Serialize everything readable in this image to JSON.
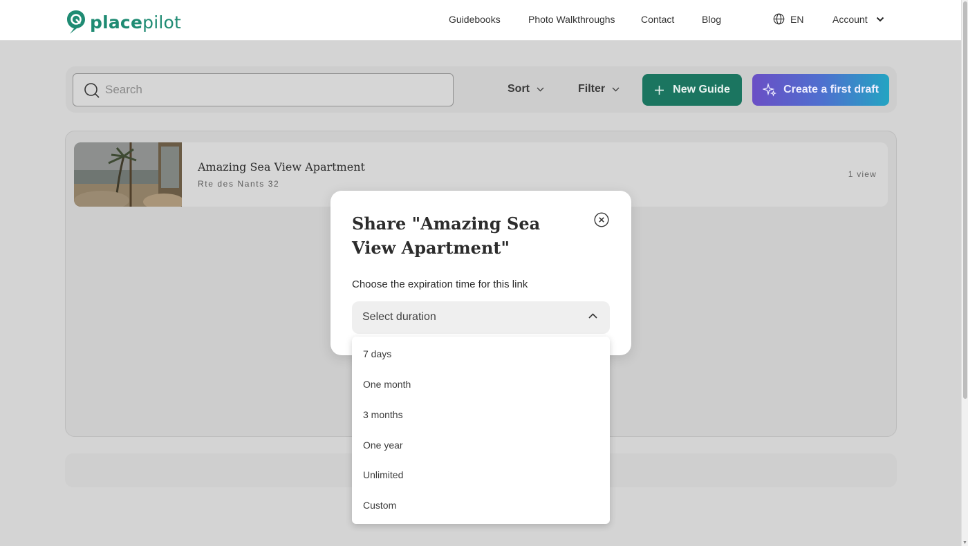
{
  "header": {
    "logo": {
      "bold": "place",
      "light": "pilot"
    },
    "nav": [
      "Guidebooks",
      "Photo Walkthroughs",
      "Contact",
      "Blog"
    ],
    "language": "EN",
    "account": "Account"
  },
  "toolbar": {
    "search_placeholder": "Search",
    "sort_label": "Sort",
    "filter_label": "Filter",
    "new_guide_label": "New Guide",
    "draft_label": "Create a first draft"
  },
  "guide": {
    "title": "Amazing Sea View Apartment",
    "address": "Rte des Nants 32",
    "views": "1 view"
  },
  "modal": {
    "title": "Share \"Amazing Sea View Apartment\"",
    "label": "Choose the expiration time for this link",
    "select_value": "Select duration",
    "options": [
      "7 days",
      "One month",
      "3 months",
      "One year",
      "Unlimited",
      "Custom"
    ]
  },
  "colors": {
    "brand": "#1f8b73",
    "new_guide_bg": "#1b7560",
    "draft_gradient_start": "#6a4fc5",
    "draft_gradient_end": "#23a4c2"
  }
}
